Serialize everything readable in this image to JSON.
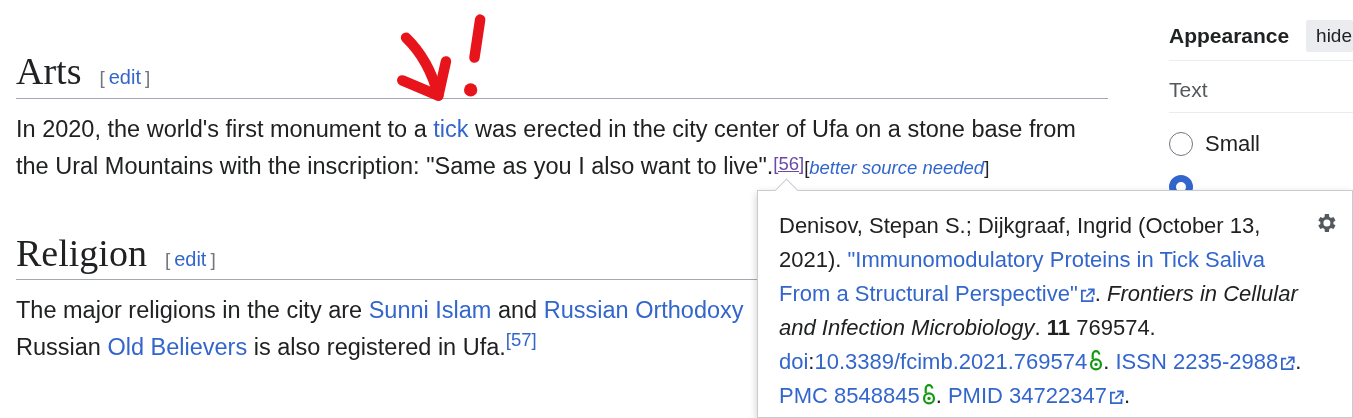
{
  "sections": [
    {
      "heading": "Arts",
      "edit_open": "[",
      "edit": "edit",
      "edit_close": "]",
      "lines": [
        [
          {
            "kind": "text",
            "text": "In 2020, the world's first monument to a "
          },
          {
            "kind": "link",
            "text": "tick"
          },
          {
            "kind": "text",
            "text": " was erected in the city center of Ufa on a stone base from"
          }
        ],
        [
          {
            "kind": "text",
            "text": "the Ural Mountains with the inscription: \"Same as you I also want to live\"."
          },
          {
            "kind": "ref-visited",
            "text": "[56]"
          },
          {
            "kind": "text",
            "text": "["
          },
          {
            "kind": "italic-link",
            "text": "better source needed"
          },
          {
            "kind": "text",
            "text": "]"
          }
        ]
      ]
    },
    {
      "heading": "Religion",
      "edit_open": "[",
      "edit": "edit",
      "edit_close": "]",
      "lines": [
        [
          {
            "kind": "text",
            "text": "The major religions in the city are "
          },
          {
            "kind": "link",
            "text": "Sunni Islam"
          },
          {
            "kind": "text",
            "text": " and "
          },
          {
            "kind": "link",
            "text": "Russian Orthodoxy"
          }
        ],
        [
          {
            "kind": "text",
            "text": "Russian "
          },
          {
            "kind": "link",
            "text": "Old Believers"
          },
          {
            "kind": "text",
            "text": " is also registered in Ufa."
          },
          {
            "kind": "ref",
            "text": "[57]"
          }
        ]
      ]
    }
  ],
  "sidebar": {
    "title": "Appearance",
    "hide_button": "hide",
    "group": "Text",
    "options": [
      {
        "label": "Small",
        "selected": false
      },
      {
        "selected": true
      }
    ]
  },
  "popup": {
    "lines": [
      [
        {
          "kind": "text",
          "text": "Denisov, Stepan S.; Dijkgraaf, Ingrid (October 13,"
        }
      ],
      [
        {
          "kind": "text",
          "text": "2021). "
        },
        {
          "kind": "link",
          "text": "\"Immunomodulatory Proteins in Tick Saliva"
        }
      ],
      [
        {
          "kind": "link",
          "text": "From a Structural Perspective\""
        },
        {
          "kind": "external"
        },
        {
          "kind": "text",
          "text": ". "
        },
        {
          "kind": "italic",
          "text": "Frontiers in Cellular"
        }
      ],
      [
        {
          "kind": "italic",
          "text": "and Infection Microbiology"
        },
        {
          "kind": "text",
          "text": ". "
        },
        {
          "kind": "bold",
          "text": "11"
        },
        {
          "kind": "text",
          "text": " 769574."
        }
      ],
      [
        {
          "kind": "link",
          "text": "doi"
        },
        {
          "kind": "text",
          "text": ":"
        },
        {
          "kind": "link",
          "text": "10.3389/fcimb.2021.769574"
        },
        {
          "kind": "open-access"
        },
        {
          "kind": "text",
          "text": ". "
        },
        {
          "kind": "link",
          "text": "ISSN 2235-2988"
        },
        {
          "kind": "external"
        },
        {
          "kind": "text",
          "text": "."
        }
      ],
      [
        {
          "kind": "link",
          "text": "PMC 8548845"
        },
        {
          "kind": "open-access"
        },
        {
          "kind": "text",
          "text": ". "
        },
        {
          "kind": "link",
          "text": "PMID 34722347"
        },
        {
          "kind": "external"
        },
        {
          "kind": "text",
          "text": "."
        }
      ]
    ]
  }
}
